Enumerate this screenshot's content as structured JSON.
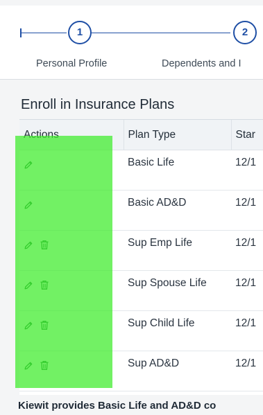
{
  "wizard": {
    "steps": [
      {
        "number": "1",
        "label": "Personal Profile"
      },
      {
        "number": "2",
        "label": "Dependents and I"
      }
    ]
  },
  "section": {
    "title": "Enroll in Insurance Plans"
  },
  "table": {
    "columns": [
      "Actions",
      "Plan Type",
      "Star"
    ],
    "rows": [
      {
        "plan_type": "Basic Life",
        "start": "12/1",
        "icons": [
          "edit-icon"
        ]
      },
      {
        "plan_type": "Basic AD&D",
        "start": "12/1",
        "icons": [
          "edit-icon"
        ]
      },
      {
        "plan_type": "Sup Emp Life",
        "start": "12/1",
        "icons": [
          "edit-icon",
          "trash-icon"
        ]
      },
      {
        "plan_type": "Sup Spouse Life",
        "start": "12/1",
        "icons": [
          "edit-icon",
          "trash-icon"
        ]
      },
      {
        "plan_type": "Sup Child Life",
        "start": "12/1",
        "icons": [
          "edit-icon",
          "trash-icon"
        ]
      },
      {
        "plan_type": "Sup AD&D",
        "start": "12/1",
        "icons": [
          "edit-icon",
          "trash-icon"
        ]
      }
    ]
  },
  "footer": {
    "note": "Kiewit provides Basic Life and AD&D co"
  },
  "colors": {
    "accent": "#1f4fa5",
    "action_icon": "#1f7a3a",
    "highlight": "#3ceb28"
  }
}
